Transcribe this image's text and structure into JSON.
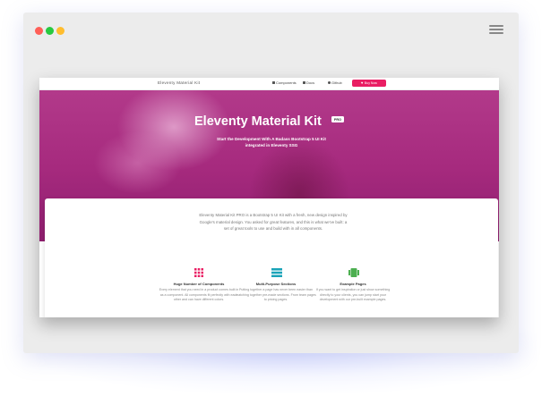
{
  "browser": {
    "controls": [
      "close",
      "minimize",
      "maximize"
    ],
    "menu_icon": "hamburger-icon"
  },
  "navbar": {
    "brand": "Eleventy Material Kit",
    "items": [
      {
        "label": "Components",
        "icon": "components-icon"
      },
      {
        "label": "Docs",
        "icon": "docs-icon"
      },
      {
        "label": "Github",
        "icon": "github-icon"
      }
    ],
    "button_label": "Buy Now",
    "button_color": "#e91e63"
  },
  "hero": {
    "title": "Eleventy Material Kit",
    "badge": "PRO",
    "subtitle": "Start the Development With A Badass Bootstrap 5 UI Kit integrated in Eleventy SSG"
  },
  "intro": {
    "text": "Eleventy Material Kit PRO is a Bootstrap 5 UI Kit with a fresh, new design inspired by Google's material design. You asked for great features, and this is what we've built: a set of great tools to use and build with in all components."
  },
  "features": [
    {
      "title": "Huge Number of Components",
      "description": "Every element that you need in a product comes built in as a component. All components fit perfectly with each other and can have different colors.",
      "icon": "grid-icon",
      "color": "#e91e63"
    },
    {
      "title": "Multi-Purpose Sections",
      "description": "Putting together a page has never been easier than matching together pre-made sections. From team pages to pricing pages.",
      "icon": "sections-icon",
      "color": "#1aa3b8"
    },
    {
      "title": "Example Pages",
      "description": "If you want to get inspiration or just show something directly to your clients, you can jump start your development with our pre-built example pages.",
      "icon": "pages-icon",
      "color": "#4caf50"
    }
  ]
}
